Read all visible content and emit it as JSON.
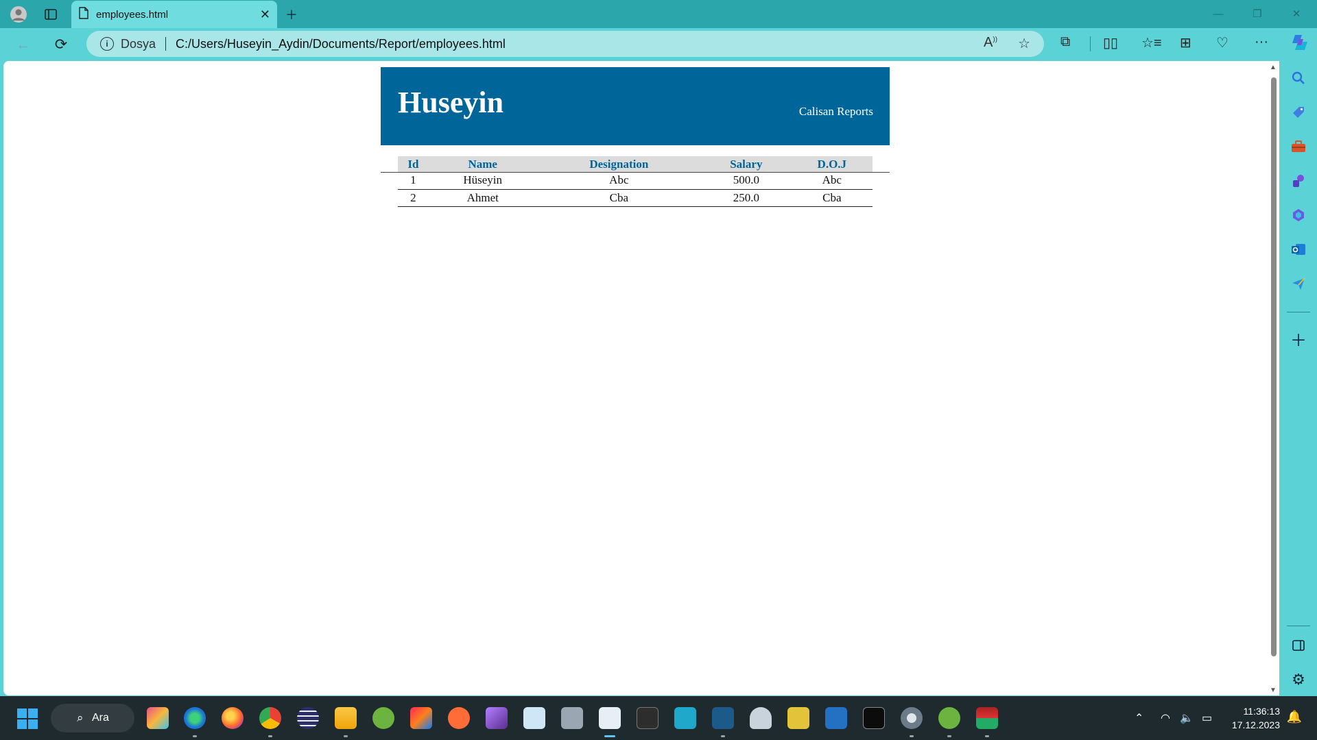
{
  "browser": {
    "tab_title": "employees.html",
    "omnibox_scheme": "Dosya",
    "url": "C:/Users/Huseyin_Aydin/Documents/Report/employees.html"
  },
  "report": {
    "title": "Huseyin",
    "subtitle": "Calisan Reports",
    "columns": [
      "Id",
      "Name",
      "Designation",
      "Salary",
      "D.O.J"
    ],
    "rows": [
      [
        "1",
        "Hüseyin",
        "Abc",
        "500.0",
        "Abc"
      ],
      [
        "2",
        "Ahmet",
        "Cba",
        "250.0",
        "Cba"
      ]
    ]
  },
  "taskbar": {
    "search_label": "Ara",
    "time": "11:36:13",
    "date": "17.12.2023"
  },
  "colors": {
    "header_bg": "#006599",
    "header_cell_bg": "#dcdcdc",
    "browser_accent": "#5bd3d6",
    "taskbar_bg": "#1f2a2f"
  }
}
